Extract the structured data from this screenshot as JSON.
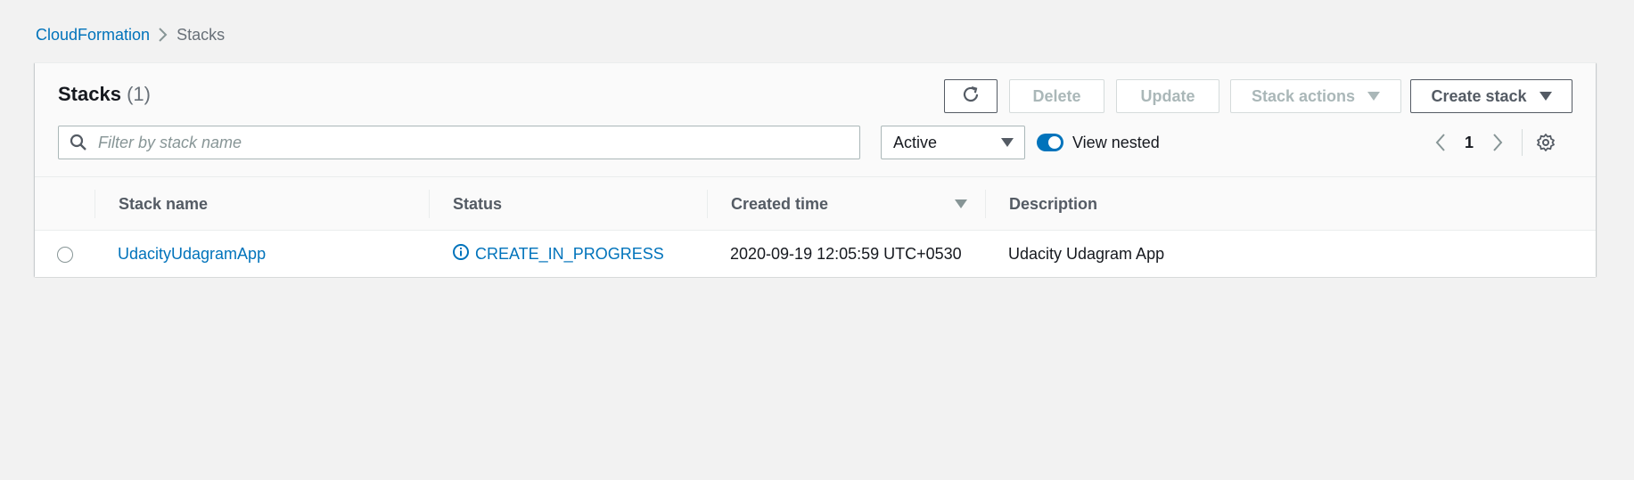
{
  "breadcrumb": {
    "root": "CloudFormation",
    "current": "Stacks"
  },
  "header": {
    "title": "Stacks",
    "count": "(1)"
  },
  "toolbar": {
    "refresh_icon": "refresh-icon",
    "delete_label": "Delete",
    "update_label": "Update",
    "stack_actions_label": "Stack actions",
    "create_stack_label": "Create stack"
  },
  "filter": {
    "placeholder": "Filter by stack name",
    "value": "",
    "status_select": "Active",
    "view_nested_label": "View nested",
    "view_nested_on": true
  },
  "pagination": {
    "current_page": "1"
  },
  "table": {
    "columns": [
      "Stack name",
      "Status",
      "Created time",
      "Description"
    ],
    "sorted_column": "Created time",
    "rows": [
      {
        "stack_name": "UdacityUdagramApp",
        "status": "CREATE_IN_PROGRESS",
        "status_icon": "info-icon",
        "created_time": "2020-09-19 12:05:59 UTC+0530",
        "description": "Udacity Udagram App"
      }
    ]
  },
  "colors": {
    "link": "#0073bb",
    "background": "#f2f2f2",
    "disabled_text": "#aab7b8",
    "header_text": "#545b64"
  }
}
